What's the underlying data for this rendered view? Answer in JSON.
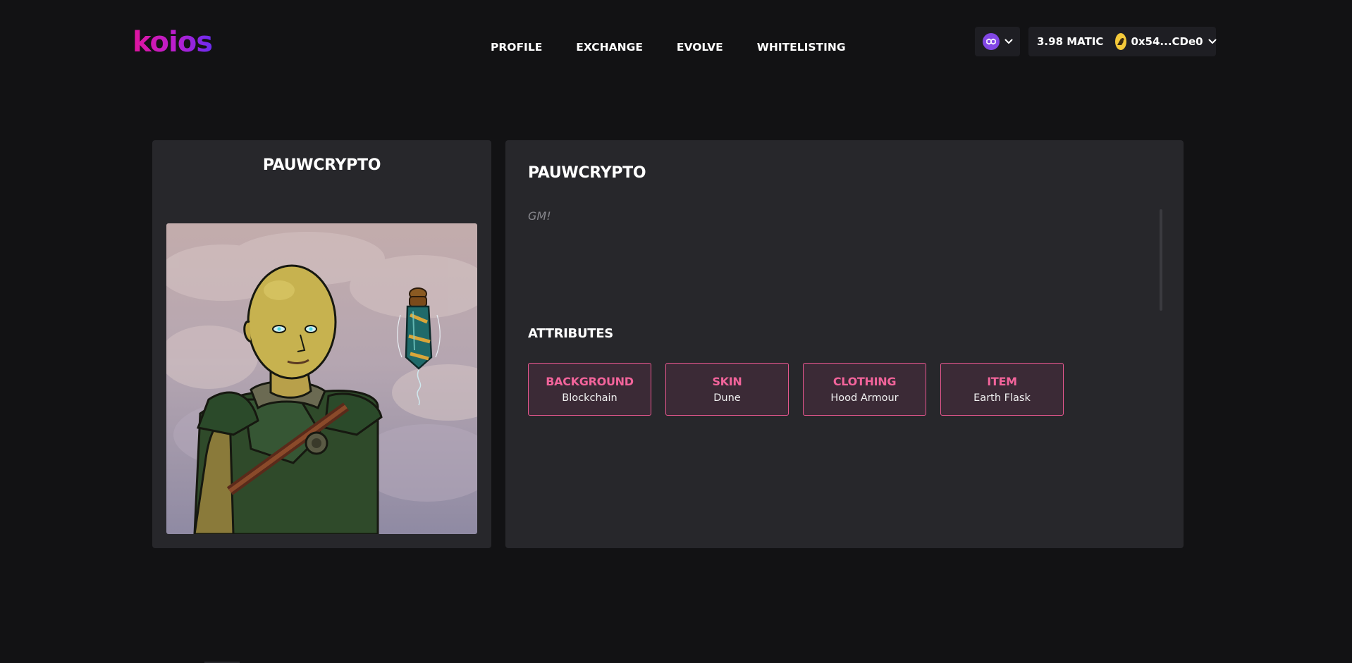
{
  "app": {
    "logo_text": "koios",
    "brand_gradient": [
      "#e0149e",
      "#6a2cf0"
    ],
    "accent_color": "#f2649b",
    "background_color": "#121214",
    "card_color": "#27272b"
  },
  "nav": {
    "items": [
      {
        "label": "PROFILE"
      },
      {
        "label": "EXCHANGE"
      },
      {
        "label": "EVOLVE"
      },
      {
        "label": "WHITELISTING"
      }
    ]
  },
  "network": {
    "icon": "polygon-icon",
    "icon_color": "#8247e5"
  },
  "wallet": {
    "balance": "3.98 MATIC",
    "address": "0x54...CDe0",
    "avatar_icon": "wallet-avatar-icon"
  },
  "nft": {
    "name": "PAUWCRYPTO",
    "image_icon": "character-portrait"
  },
  "details": {
    "name": "PAUWCRYPTO",
    "bio": "GM!",
    "attributes_heading": "ATTRIBUTES",
    "attributes": [
      {
        "type": "BACKGROUND",
        "value": "Blockchain"
      },
      {
        "type": "SKIN",
        "value": "Dune"
      },
      {
        "type": "CLOTHING",
        "value": "Hood Armour"
      },
      {
        "type": "ITEM",
        "value": "Earth Flask"
      }
    ]
  }
}
